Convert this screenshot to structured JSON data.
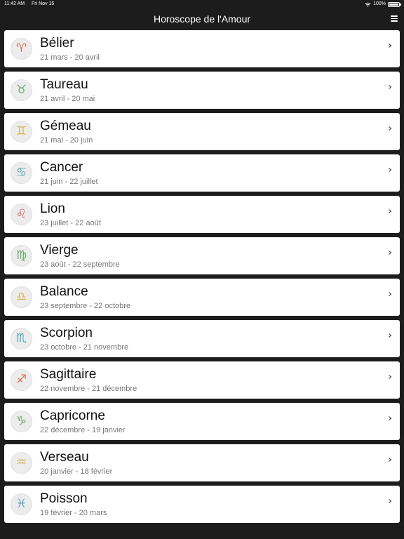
{
  "status_bar": {
    "time": "11:42 AM",
    "date": "Fri Nov 15",
    "battery": "100%"
  },
  "navbar": {
    "title": "Horoscope de l'Amour"
  },
  "signs": [
    {
      "name": "Bélier",
      "dates": "21 mars - 20 avril",
      "icon": "aries-icon",
      "glyph": "♈",
      "color": "#d86a5a"
    },
    {
      "name": "Taureau",
      "dates": "21 avril - 20 mai",
      "icon": "taurus-icon",
      "glyph": "♉",
      "color": "#6fa87a"
    },
    {
      "name": "Gémeau",
      "dates": "21 mai - 20 juin",
      "icon": "gemini-icon",
      "glyph": "♊",
      "color": "#d6b45a"
    },
    {
      "name": "Cancer",
      "dates": "21 juin - 22 juillet",
      "icon": "cancer-icon",
      "glyph": "♋",
      "color": "#5aa8b0"
    },
    {
      "name": "Lion",
      "dates": "23 juillet - 22 août",
      "icon": "leo-icon",
      "glyph": "♌",
      "color": "#d8645a"
    },
    {
      "name": "Vierge",
      "dates": "23 août - 22 septembre",
      "icon": "virgo-icon",
      "glyph": "♍",
      "color": "#6aaa6e"
    },
    {
      "name": "Balance",
      "dates": "23 septembre - 22 octobre",
      "icon": "libra-icon",
      "glyph": "♎",
      "color": "#d8b25e"
    },
    {
      "name": "Scorpion",
      "dates": "23 octobre - 21 novembre",
      "icon": "scorpio-icon",
      "glyph": "♏",
      "color": "#4fa6b8"
    },
    {
      "name": "Sagittaire",
      "dates": "22 novembre - 21 décembre",
      "icon": "sagittarius-icon",
      "glyph": "♐",
      "color": "#d8705a"
    },
    {
      "name": "Capricorne",
      "dates": "22 décembre - 19 janvier",
      "icon": "capricorn-icon",
      "glyph": "♑",
      "color": "#6aa873"
    },
    {
      "name": "Verseau",
      "dates": "20 janvier - 18 février",
      "icon": "aquarius-icon",
      "glyph": "♒",
      "color": "#d4b460"
    },
    {
      "name": "Poisson",
      "dates": "19 février - 20 mars",
      "icon": "pisces-icon",
      "glyph": "♓",
      "color": "#56a6b8"
    }
  ]
}
